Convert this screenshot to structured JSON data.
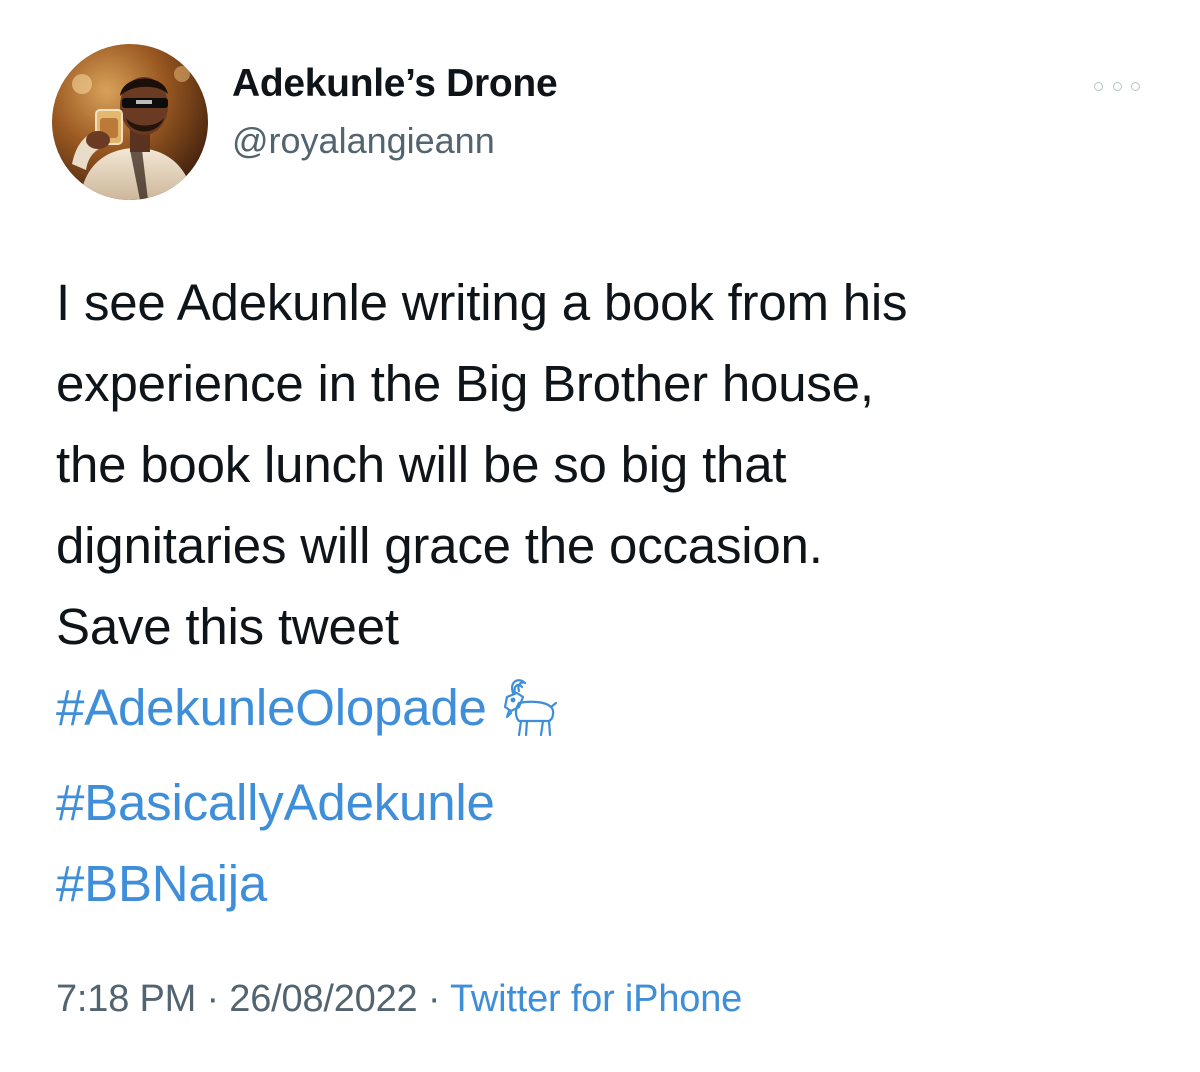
{
  "author": {
    "display_name": "Adekunle’s Drone",
    "handle": "@royalangieann"
  },
  "tweet": {
    "lines": [
      "I see Adekunle writing a book from his",
      "experience in the Big Brother house,",
      "the book lunch will be so big that",
      "dignitaries will grace the occasion.",
      "Save this tweet"
    ],
    "hashtags": [
      "#AdekunleOlopade",
      "#BasicallyAdekunle",
      "#BBNaija"
    ],
    "emoji_after_first_hashtag": "goat-emoji"
  },
  "meta": {
    "time": "7:18 PM",
    "separator": " · ",
    "date": "26/08/2022",
    "source": "Twitter for iPhone"
  },
  "icons": {
    "more": "more-options-icon",
    "avatar": "profile-avatar"
  },
  "colors": {
    "text": "#0f1419",
    "secondary": "#536471",
    "link": "#3e8ed9",
    "background": "#ffffff"
  }
}
